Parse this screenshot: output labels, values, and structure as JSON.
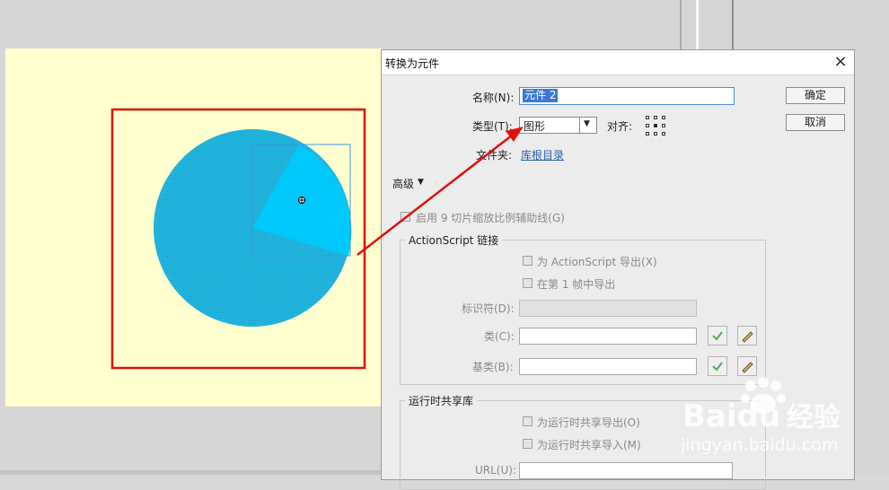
{
  "dialog": {
    "title": "转换为元件",
    "close_glyph": "×",
    "name_label": "名称(N):",
    "name_value": "元件 2",
    "type_label": "类型(T):",
    "type_value": "图形",
    "align_label": "对齐:",
    "folder_label": "文件夹:",
    "folder_link": "库根目录",
    "ok_label": "确定",
    "cancel_label": "取消",
    "advanced_label": "高级",
    "enable_9slice_label": "启用 9 切片缩放比例辅助线(G)",
    "actionscript_group": {
      "title": "ActionScript 链接",
      "export_as_label": "为 ActionScript 导出(X)",
      "export_frame_label": "在第 1 帧中导出",
      "identifier_label": "标识符(D):",
      "class_label": "类(C):",
      "base_class_label": "基类(B):"
    },
    "runtime_group": {
      "title": "运行时共享库",
      "export_sharing_label": "为运行时共享导出(O)",
      "import_sharing_label": "为运行时共享导入(M)",
      "url_label": "URL(U):"
    }
  },
  "watermark": {
    "brand": "Baidu",
    "brand_cn": "经验",
    "url": "jingyan.baidu.com"
  },
  "colors": {
    "stage_bg": "#ffffcf",
    "pie_main": "#1fb4dd",
    "pie_slice": "#00c8fb",
    "highlight_red": "#e01010",
    "selection_blue": "#3a78d6"
  }
}
